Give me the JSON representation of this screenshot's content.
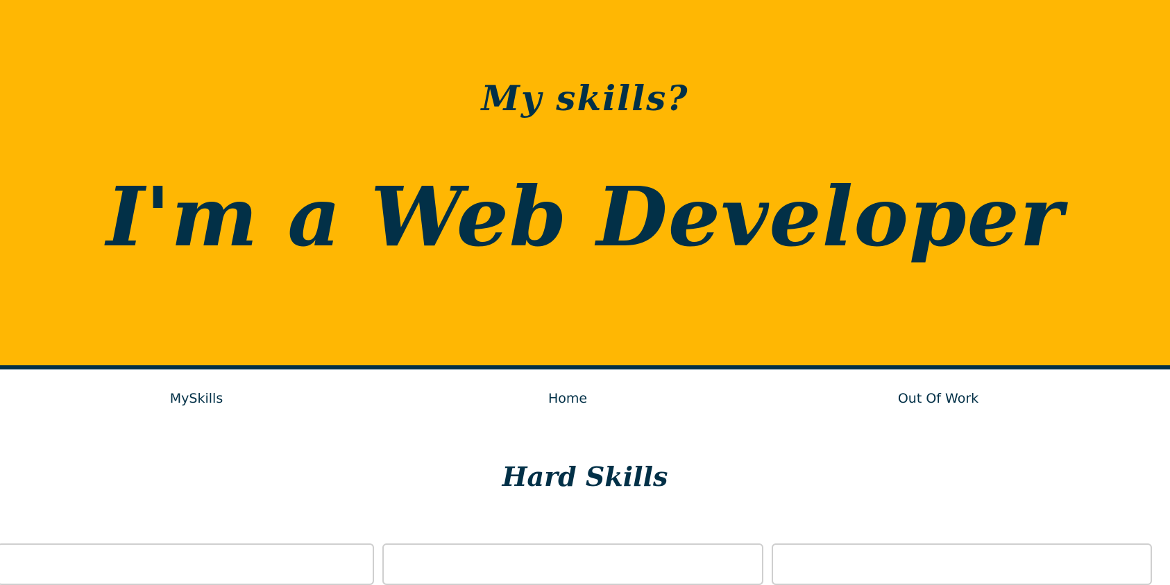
{
  "hero": {
    "subtitle": "My skills?",
    "title": "I'm a Web Developer"
  },
  "nav": {
    "items": [
      {
        "label": "MySkills"
      },
      {
        "label": "Home"
      },
      {
        "label": "Out Of Work"
      }
    ]
  },
  "section": {
    "title": "Hard Skills"
  },
  "colors": {
    "accent": "#ffb703",
    "primary": "#023047",
    "card_border": "#cfcfcf"
  }
}
